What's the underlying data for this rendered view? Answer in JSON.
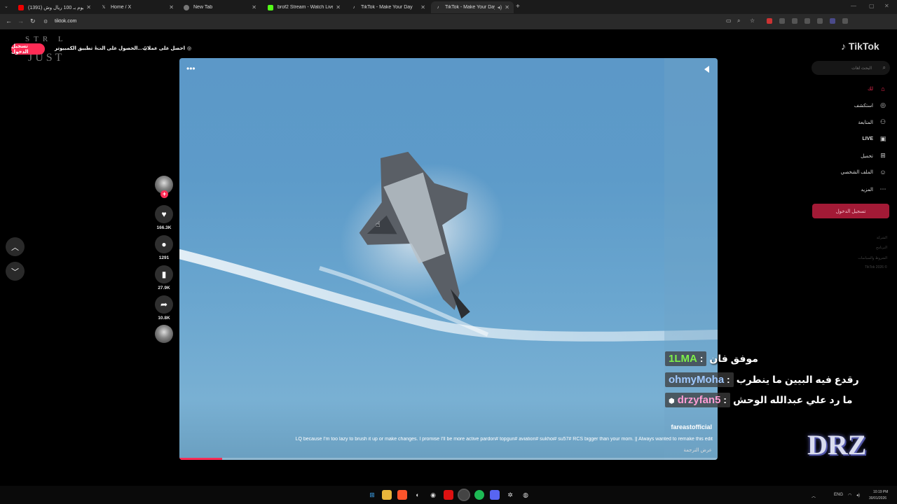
{
  "browser": {
    "tabs": [
      {
        "title": "(1391) عشان يوم بـ 100 ريال وش..."
      },
      {
        "title": "Home / X"
      },
      {
        "title": "New Tab"
      },
      {
        "title": "brof2 Stream - Watch Live on..."
      },
      {
        "title": "TikTok - Make Your Day"
      },
      {
        "title": "TikTok - Make Your Day"
      }
    ],
    "new_tab": "+",
    "url": "tiktok.com"
  },
  "topbar": {
    "login": "تسجيل الدخول",
    "options": [
      "تطبيق الكمبيوتر",
      "الحصول على الت...",
      "احصل على عملات"
    ]
  },
  "deco": {
    "letters": "STR L",
    "just": "JUST"
  },
  "video": {
    "author": "fareastofficial",
    "caption": "LQ because I'm too lazy to brush it up or make changes. I promise I'll be more active pardon# topgun# aviation# sukhoi# su57# RCS bigger than your mom. || Always wanted to remake this edit",
    "translate": "عرض الترجمة",
    "more": "•••",
    "progress": 0.08
  },
  "actions": {
    "likes": "166.3K",
    "comments": "1291",
    "saves": "27.9K",
    "shares": "10.8K"
  },
  "sidebar": {
    "brand": "TikTok",
    "search_placeholder": "البحث لغات",
    "items": [
      {
        "label": "لك",
        "icon": "home-icon"
      },
      {
        "label": "استكشف",
        "icon": "compass-icon"
      },
      {
        "label": "المتابعة",
        "icon": "following-icon"
      },
      {
        "label": "LIVE",
        "icon": "live-icon"
      },
      {
        "label": "تحميل",
        "icon": "upload-icon"
      },
      {
        "label": "الملف الشخصي",
        "icon": "profile-icon"
      },
      {
        "label": "المزيد",
        "icon": "more-icon"
      }
    ],
    "login": "تسجيل الدخول",
    "footer": [
      "الشركة",
      "البرنامج",
      "الشروط والسياسات",
      "TikTok 2026 ©"
    ]
  },
  "chat": [
    {
      "name": "1LMA",
      "sep": " : ",
      "msg": "موفق فان",
      "color": "#7cf04a"
    },
    {
      "name": "ohmyMoha",
      "sep": " : ",
      "msg": "رقدع فيه البيين ما ينطرب",
      "color": "#9fc8ff"
    },
    {
      "name": "drzyfan5",
      "sep": " : ",
      "msg": "ما رد علي عبدالله الوحش",
      "color": "#ff9dd5"
    }
  ],
  "logo": "DRZ",
  "taskbar": {
    "lang": "ENG",
    "time": "10:19 PM",
    "date": "30/01/2026"
  },
  "colors": {
    "accent": "#fe2c55",
    "sky": "#5d9bc9"
  }
}
